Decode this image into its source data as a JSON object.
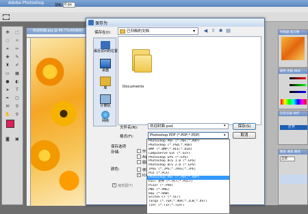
{
  "photoshop": {
    "title": "Adobe Photoshop",
    "options": {
      "feather_label": "羽化:",
      "feather_value": "0 px",
      "antialias_label": "消除锯齿",
      "style_label": "样式:",
      "style_value": "正常",
      "width_label": "宽度:"
    },
    "document_title": "欢迎封面.jpg @ 66.7%(RGB/8)",
    "panels": [
      {
        "title": "导航器 直方图"
      },
      {
        "title": "颜色 色板 样式"
      },
      {
        "title": "历史记录 动作"
      },
      {
        "title": "图层 通道 路径"
      }
    ],
    "history_item": "打开",
    "layers_mode": "正常",
    "fg_color": "#e01f5b",
    "bg_color": "#ffffff"
  },
  "dialog": {
    "title": "保存为",
    "save_in_label": "保存在(I):",
    "save_in_value": "已归档的文档",
    "places": [
      {
        "label": "最近访问的位置",
        "icon": "recent-places-icon"
      },
      {
        "label": "桌面",
        "icon": "desktop-icon"
      },
      {
        "label": "库",
        "icon": "libraries-icon"
      },
      {
        "label": "计算机",
        "icon": "computer-icon"
      },
      {
        "label": "网络",
        "icon": "network-icon"
      }
    ],
    "file_item": "Documents",
    "filename_label": "文件名(N):",
    "filename_value": "欢迎封面.psd",
    "format_label": "格式(F):",
    "format_value": "Photoshop PDF (*.PDF;*.PDP)",
    "save_button": "保存(S)",
    "cancel_button": "取消",
    "save_options_label": "保存选项",
    "store_label": "存储:",
    "store_options": [
      "作为副本",
      "Alpha 通道",
      "图层"
    ],
    "color_label": "颜色:",
    "color_options": [
      "使用校样设置",
      "ICC 配置文件"
    ],
    "thumbnail_label": "缩览图(T)",
    "format_list": [
      "Photoshop PDF (*.PDF;*.PDP)",
      "Photoshop (*.PSD;*.PDD)",
      "BMP (*.BMP;*.RLE;*.DIB)",
      "CompuServe GIF (*.GIF)",
      "Photoshop EPS (*.EPS)",
      "Photoshop DCS 1.0 (*.EPS)",
      "Photoshop DCS 2.0 (*.EPS)",
      "JPEG (*.JPG;*.JPEG;*.JPE)",
      "PCX (*.PCX)",
      "Photoshop PDF (*.PDF;*.PDP)",
      "PICT 文件 (*.PCT;*.PICT)",
      "Pixar (*.PXR)",
      "PNG (*.PNG)",
      "Raw (*.RAW)",
      "Scitex CT (*.SCT)",
      "Targa (*.TGA;*.VDA;*.ICB;*.VST)",
      "TIFF (*.TIF;*.TIFF)"
    ],
    "format_selected_index": 9
  }
}
